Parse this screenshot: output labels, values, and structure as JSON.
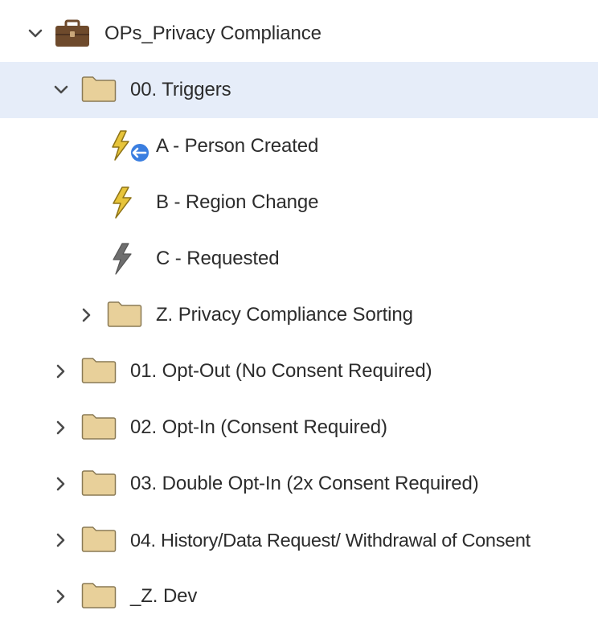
{
  "tree": {
    "root": {
      "label": "OPs_Privacy Compliance",
      "icon": "briefcase-icon",
      "expanded": true
    },
    "triggers": {
      "label": "00. Triggers",
      "icon": "folder-icon",
      "expanded": true,
      "selected": true
    },
    "trigger_a": {
      "label": "A - Person Created",
      "icon": "trigger-bolt-with-arrow-icon"
    },
    "trigger_b": {
      "label": "B - Region Change",
      "icon": "trigger-bolt-icon"
    },
    "trigger_c": {
      "label": "C - Requested",
      "icon": "trigger-bolt-inactive-icon"
    },
    "sorting": {
      "label": "Z. Privacy Compliance Sorting",
      "icon": "folder-icon",
      "expanded": false
    },
    "opt_out": {
      "label": "01. Opt-Out (No Consent Required)",
      "icon": "folder-icon",
      "expanded": false
    },
    "opt_in": {
      "label": "02. Opt-In (Consent Required)",
      "icon": "folder-icon",
      "expanded": false
    },
    "double_opt_in": {
      "label": "03. Double Opt-In (2x Consent Required)",
      "icon": "folder-icon",
      "expanded": false
    },
    "history": {
      "label": "04. History/Data Request/ Withdrawal of Consent",
      "icon": "folder-icon",
      "expanded": false
    },
    "dev": {
      "label": "_Z. Dev",
      "icon": "folder-icon",
      "expanded": false
    }
  },
  "colors": {
    "selected_row": "#e6edf9",
    "folder_fill": "#e8d09a",
    "folder_stroke": "#8a7a55",
    "briefcase": "#6e4a2c",
    "bolt_active": "#e7c43a",
    "bolt_inactive": "#6e6e6e",
    "badge_blue": "#3a7ee0"
  }
}
